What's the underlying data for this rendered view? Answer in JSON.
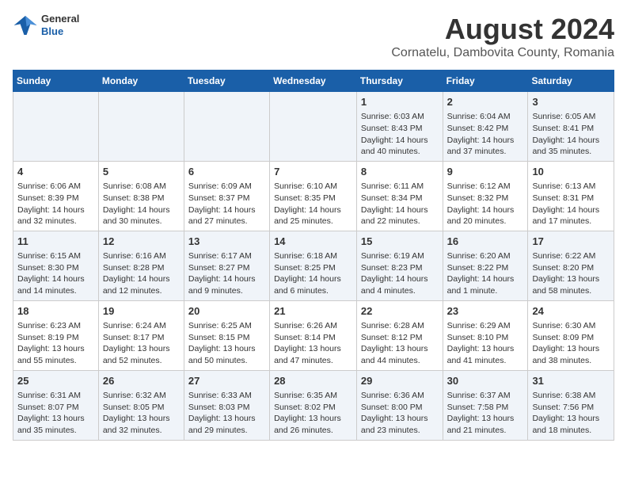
{
  "header": {
    "logo_general": "General",
    "logo_blue": "Blue",
    "title": "August 2024",
    "subtitle": "Cornatelu, Dambovita County, Romania"
  },
  "days_of_week": [
    "Sunday",
    "Monday",
    "Tuesday",
    "Wednesday",
    "Thursday",
    "Friday",
    "Saturday"
  ],
  "weeks": [
    [
      {
        "day": "",
        "info": ""
      },
      {
        "day": "",
        "info": ""
      },
      {
        "day": "",
        "info": ""
      },
      {
        "day": "",
        "info": ""
      },
      {
        "day": "1",
        "info": "Sunrise: 6:03 AM\nSunset: 8:43 PM\nDaylight: 14 hours and 40 minutes."
      },
      {
        "day": "2",
        "info": "Sunrise: 6:04 AM\nSunset: 8:42 PM\nDaylight: 14 hours and 37 minutes."
      },
      {
        "day": "3",
        "info": "Sunrise: 6:05 AM\nSunset: 8:41 PM\nDaylight: 14 hours and 35 minutes."
      }
    ],
    [
      {
        "day": "4",
        "info": "Sunrise: 6:06 AM\nSunset: 8:39 PM\nDaylight: 14 hours and 32 minutes."
      },
      {
        "day": "5",
        "info": "Sunrise: 6:08 AM\nSunset: 8:38 PM\nDaylight: 14 hours and 30 minutes."
      },
      {
        "day": "6",
        "info": "Sunrise: 6:09 AM\nSunset: 8:37 PM\nDaylight: 14 hours and 27 minutes."
      },
      {
        "day": "7",
        "info": "Sunrise: 6:10 AM\nSunset: 8:35 PM\nDaylight: 14 hours and 25 minutes."
      },
      {
        "day": "8",
        "info": "Sunrise: 6:11 AM\nSunset: 8:34 PM\nDaylight: 14 hours and 22 minutes."
      },
      {
        "day": "9",
        "info": "Sunrise: 6:12 AM\nSunset: 8:32 PM\nDaylight: 14 hours and 20 minutes."
      },
      {
        "day": "10",
        "info": "Sunrise: 6:13 AM\nSunset: 8:31 PM\nDaylight: 14 hours and 17 minutes."
      }
    ],
    [
      {
        "day": "11",
        "info": "Sunrise: 6:15 AM\nSunset: 8:30 PM\nDaylight: 14 hours and 14 minutes."
      },
      {
        "day": "12",
        "info": "Sunrise: 6:16 AM\nSunset: 8:28 PM\nDaylight: 14 hours and 12 minutes."
      },
      {
        "day": "13",
        "info": "Sunrise: 6:17 AM\nSunset: 8:27 PM\nDaylight: 14 hours and 9 minutes."
      },
      {
        "day": "14",
        "info": "Sunrise: 6:18 AM\nSunset: 8:25 PM\nDaylight: 14 hours and 6 minutes."
      },
      {
        "day": "15",
        "info": "Sunrise: 6:19 AM\nSunset: 8:23 PM\nDaylight: 14 hours and 4 minutes."
      },
      {
        "day": "16",
        "info": "Sunrise: 6:20 AM\nSunset: 8:22 PM\nDaylight: 14 hours and 1 minute."
      },
      {
        "day": "17",
        "info": "Sunrise: 6:22 AM\nSunset: 8:20 PM\nDaylight: 13 hours and 58 minutes."
      }
    ],
    [
      {
        "day": "18",
        "info": "Sunrise: 6:23 AM\nSunset: 8:19 PM\nDaylight: 13 hours and 55 minutes."
      },
      {
        "day": "19",
        "info": "Sunrise: 6:24 AM\nSunset: 8:17 PM\nDaylight: 13 hours and 52 minutes."
      },
      {
        "day": "20",
        "info": "Sunrise: 6:25 AM\nSunset: 8:15 PM\nDaylight: 13 hours and 50 minutes."
      },
      {
        "day": "21",
        "info": "Sunrise: 6:26 AM\nSunset: 8:14 PM\nDaylight: 13 hours and 47 minutes."
      },
      {
        "day": "22",
        "info": "Sunrise: 6:28 AM\nSunset: 8:12 PM\nDaylight: 13 hours and 44 minutes."
      },
      {
        "day": "23",
        "info": "Sunrise: 6:29 AM\nSunset: 8:10 PM\nDaylight: 13 hours and 41 minutes."
      },
      {
        "day": "24",
        "info": "Sunrise: 6:30 AM\nSunset: 8:09 PM\nDaylight: 13 hours and 38 minutes."
      }
    ],
    [
      {
        "day": "25",
        "info": "Sunrise: 6:31 AM\nSunset: 8:07 PM\nDaylight: 13 hours and 35 minutes."
      },
      {
        "day": "26",
        "info": "Sunrise: 6:32 AM\nSunset: 8:05 PM\nDaylight: 13 hours and 32 minutes."
      },
      {
        "day": "27",
        "info": "Sunrise: 6:33 AM\nSunset: 8:03 PM\nDaylight: 13 hours and 29 minutes."
      },
      {
        "day": "28",
        "info": "Sunrise: 6:35 AM\nSunset: 8:02 PM\nDaylight: 13 hours and 26 minutes."
      },
      {
        "day": "29",
        "info": "Sunrise: 6:36 AM\nSunset: 8:00 PM\nDaylight: 13 hours and 23 minutes."
      },
      {
        "day": "30",
        "info": "Sunrise: 6:37 AM\nSunset: 7:58 PM\nDaylight: 13 hours and 21 minutes."
      },
      {
        "day": "31",
        "info": "Sunrise: 6:38 AM\nSunset: 7:56 PM\nDaylight: 13 hours and 18 minutes."
      }
    ]
  ]
}
